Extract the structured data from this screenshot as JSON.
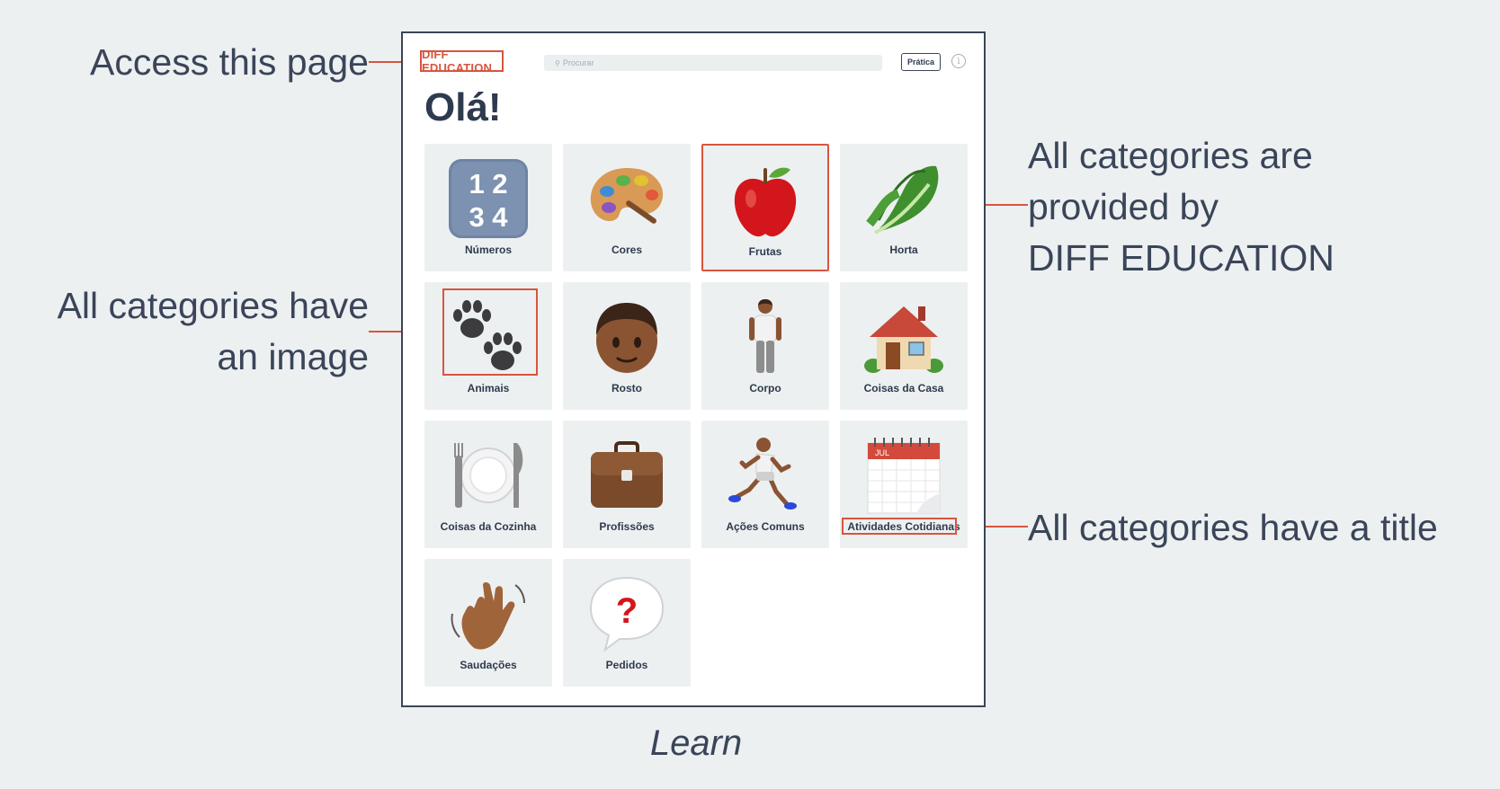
{
  "annotations": {
    "access": "Access this page",
    "provided": [
      "All categories are",
      "provided by",
      "DIFF EDUCATION"
    ],
    "image": [
      "All categories have",
      "an image"
    ],
    "title": "All categories have a title"
  },
  "app": {
    "brand": "DIFF EDUCATION",
    "search_placeholder": "Procurar",
    "practice_label": "Prática",
    "info_glyph": "i",
    "greeting": "Olá!"
  },
  "categories": [
    {
      "title": "Números",
      "icon": "numbers-icon"
    },
    {
      "title": "Cores",
      "icon": "palette-icon"
    },
    {
      "title": "Frutas",
      "icon": "apple-icon"
    },
    {
      "title": "Horta",
      "icon": "lettuce-icon"
    },
    {
      "title": "Animais",
      "icon": "paw-prints-icon"
    },
    {
      "title": "Rosto",
      "icon": "face-icon"
    },
    {
      "title": "Corpo",
      "icon": "person-icon"
    },
    {
      "title": "Coisas da Casa",
      "icon": "house-icon"
    },
    {
      "title": "Coisas da Cozinha",
      "icon": "plate-fork-knife-icon"
    },
    {
      "title": "Profissões",
      "icon": "briefcase-icon"
    },
    {
      "title": "Ações Comuns",
      "icon": "runner-icon"
    },
    {
      "title": "Atividades Cotidianas",
      "icon": "calendar-icon"
    },
    {
      "title": "Saudações",
      "icon": "waving-hand-icon"
    },
    {
      "title": "Pedidos",
      "icon": "question-bubble-icon"
    }
  ],
  "icon_texts": {
    "numbers_top": "1 2",
    "numbers_bottom": "3 4",
    "calendar_month": "JUL",
    "question_mark": "?"
  },
  "caption": "Learn",
  "colors": {
    "accent": "#d8553e",
    "text": "#2e3a4d",
    "background": "#edf0f1"
  }
}
